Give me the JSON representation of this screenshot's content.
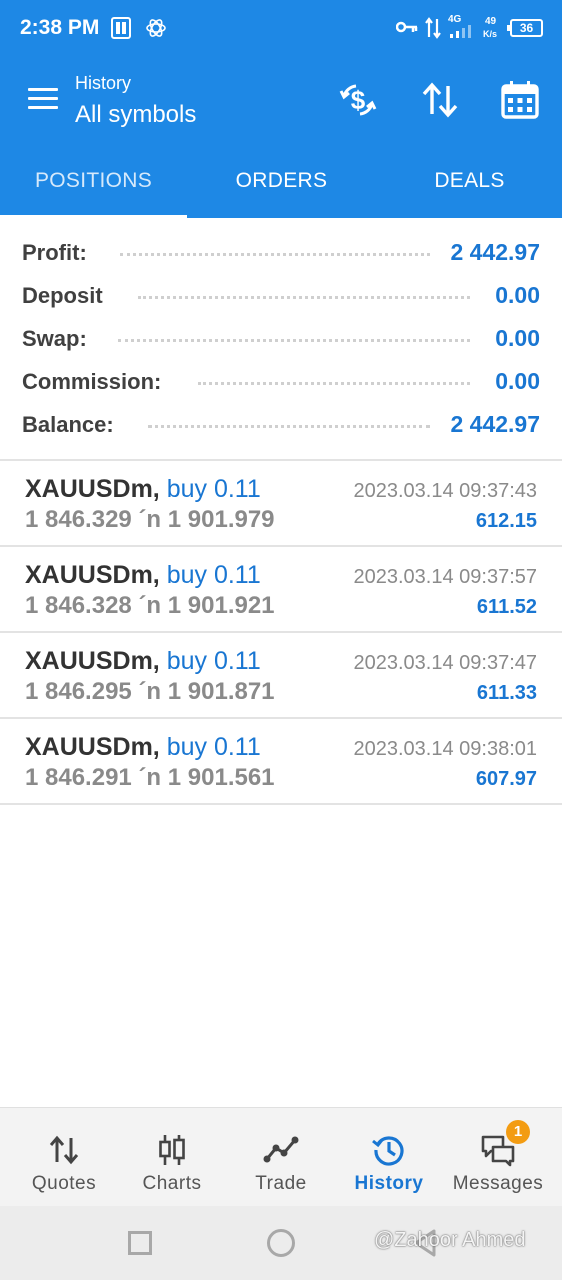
{
  "status_bar": {
    "time": "2:38 PM",
    "network_type": "4G",
    "speed_value": "49",
    "speed_unit": "K/s",
    "battery": "36",
    "icons": [
      "pi-app-icon",
      "atom-icon",
      "key-icon",
      "data-arrows-icon",
      "signal-icon",
      "battery-icon"
    ]
  },
  "toolbar": {
    "subtitle": "History",
    "title": "All symbols",
    "icons": [
      "menu-icon",
      "deposit-withdraw-icon",
      "sort-icon",
      "calendar-icon"
    ]
  },
  "tabs": [
    {
      "label": "POSITIONS",
      "active": true
    },
    {
      "label": "ORDERS",
      "active": false
    },
    {
      "label": "DEALS",
      "active": false
    }
  ],
  "summary": [
    {
      "label": "Profit:",
      "value": "2 442.97"
    },
    {
      "label": "Deposit",
      "value": "0.00"
    },
    {
      "label": "Swap:",
      "value": "0.00"
    },
    {
      "label": "Commission:",
      "value": "0.00"
    },
    {
      "label": "Balance:",
      "value": "2 442.97"
    }
  ],
  "positions": [
    {
      "symbol": "XAUUSDm,",
      "type": "buy 0.11",
      "prices": "1 846.329 ´n  1 901.979",
      "time": "2023.03.14 09:37:43",
      "profit": "612.15"
    },
    {
      "symbol": "XAUUSDm,",
      "type": "buy 0.11",
      "prices": "1 846.328 ´n  1 901.921",
      "time": "2023.03.14 09:37:57",
      "profit": "611.52"
    },
    {
      "symbol": "XAUUSDm,",
      "type": "buy 0.11",
      "prices": "1 846.295 ´n  1 901.871",
      "time": "2023.03.14 09:37:47",
      "profit": "611.33"
    },
    {
      "symbol": "XAUUSDm,",
      "type": "buy 0.11",
      "prices": "1 846.291 ´n  1 901.561",
      "time": "2023.03.14 09:38:01",
      "profit": "607.97"
    }
  ],
  "bottom_nav": [
    {
      "label": "Quotes",
      "icon": "quotes-icon",
      "active": false
    },
    {
      "label": "Charts",
      "icon": "charts-icon",
      "active": false
    },
    {
      "label": "Trade",
      "icon": "trade-icon",
      "active": false
    },
    {
      "label": "History",
      "icon": "history-icon",
      "active": true
    },
    {
      "label": "Messages",
      "icon": "messages-icon",
      "active": false,
      "badge": "1"
    }
  ],
  "watermark": "@Zahoor Ahmed",
  "colors": {
    "primary": "#1e88e5",
    "accent_text": "#1976d2",
    "badge": "#f39c12"
  }
}
